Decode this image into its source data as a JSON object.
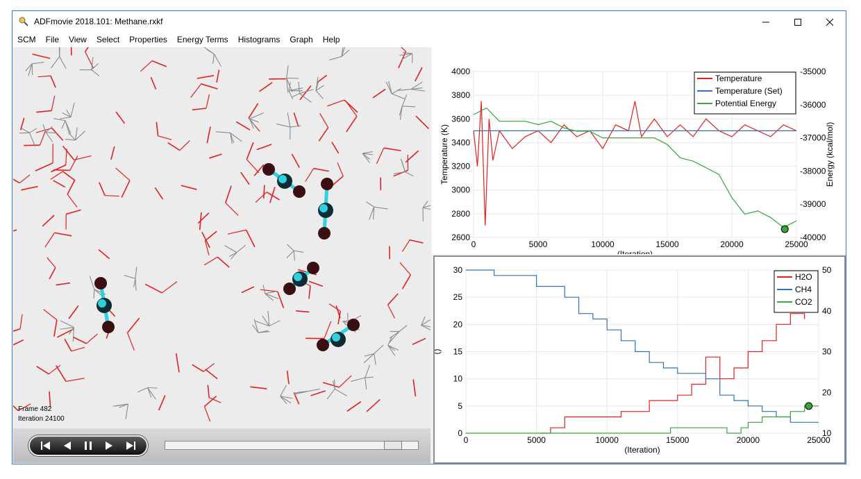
{
  "window": {
    "title": "ADFmovie 2018.101: Methane.rxkf"
  },
  "menu": [
    "SCM",
    "File",
    "View",
    "Select",
    "Properties",
    "Energy Terms",
    "Histograms",
    "Graph",
    "Help"
  ],
  "viewport": {
    "frame_label": "Frame 482",
    "iteration_label": "Iteration 24100"
  },
  "playback": {
    "position_fraction": 0.925
  },
  "colors": {
    "temperature": "#e02020",
    "temperature_set": "#2e74b5",
    "potential": "#3aa53a",
    "h2o": "#e02020",
    "ch4": "#2e74b5",
    "co2": "#3aa53a",
    "oxygen": "#3a0f12",
    "carbon": "#2fd0e0"
  },
  "chart_data": [
    {
      "type": "line",
      "xlabel": "(Iteration)",
      "ylabel": "Temperature (K)",
      "y2label": "Energy (kcal/mol)",
      "xlim": [
        0,
        25000
      ],
      "ylim": [
        2600,
        4000
      ],
      "y2lim": [
        -40000,
        -35000
      ],
      "xticks": [
        "0",
        "5000",
        "10000",
        "15000",
        "20000",
        "25000"
      ],
      "yticks": [
        "2600",
        "2800",
        "3000",
        "3200",
        "3400",
        "3600",
        "3800",
        "4000"
      ],
      "y2ticks": [
        "-40000",
        "-39000",
        "-38000",
        "-37000",
        "-36000",
        "-35000"
      ],
      "legend_position": "top-right",
      "grid": true,
      "marker": {
        "x": 24100,
        "y2": -39750
      },
      "series": [
        {
          "name": "Temperature",
          "axis": "left",
          "x": [
            0,
            300,
            600,
            900,
            1200,
            1500,
            2000,
            3000,
            4000,
            5000,
            6000,
            7000,
            8000,
            9000,
            10000,
            11000,
            12000,
            12500,
            13000,
            14000,
            15000,
            16000,
            17000,
            18000,
            19000,
            20000,
            21000,
            22000,
            23000,
            24000,
            25000
          ],
          "values": [
            3500,
            3200,
            3750,
            2700,
            3600,
            3250,
            3500,
            3350,
            3450,
            3500,
            3400,
            3550,
            3450,
            3500,
            3350,
            3550,
            3500,
            3750,
            3450,
            3600,
            3450,
            3550,
            3450,
            3600,
            3500,
            3450,
            3550,
            3500,
            3450,
            3550,
            3500
          ]
        },
        {
          "name": "Temperature (Set)",
          "axis": "left",
          "x": [
            0,
            25000
          ],
          "values": [
            3500,
            3500
          ]
        },
        {
          "name": "Potential Energy",
          "axis": "right",
          "x": [
            0,
            1000,
            2000,
            3000,
            4000,
            5000,
            6000,
            7000,
            8000,
            9000,
            10000,
            11000,
            12000,
            13000,
            14000,
            15000,
            16000,
            17000,
            18000,
            19000,
            20000,
            21000,
            22000,
            23000,
            24000,
            25000
          ],
          "values": [
            -36300,
            -36100,
            -36500,
            -36500,
            -36500,
            -36600,
            -36500,
            -36700,
            -36800,
            -36800,
            -37000,
            -37000,
            -37000,
            -37000,
            -37000,
            -37200,
            -37600,
            -37700,
            -37900,
            -38100,
            -38800,
            -39300,
            -39200,
            -39400,
            -39700,
            -39500
          ]
        }
      ]
    },
    {
      "type": "line",
      "xlabel": "(Iteration)",
      "ylabel": "()",
      "y2label": "()",
      "xlim": [
        0,
        25000
      ],
      "ylim": [
        0,
        30
      ],
      "y2lim": [
        10,
        50
      ],
      "xticks": [
        "0",
        "5000",
        "10000",
        "15000",
        "20000",
        "25000"
      ],
      "yticks": [
        "0",
        "5",
        "10",
        "15",
        "20",
        "25",
        "30"
      ],
      "y2ticks": [
        "10",
        "20",
        "30",
        "40",
        "50"
      ],
      "legend_position": "top-right",
      "grid": true,
      "marker": {
        "x": 24300,
        "y": 5
      },
      "series": [
        {
          "name": "H2O",
          "x": [
            5300,
            5700,
            6000,
            6500,
            7000,
            8000,
            10000,
            11000,
            12000,
            13000,
            14000,
            15000,
            16000,
            17000,
            17500,
            18000,
            19000,
            20000,
            21000,
            22000,
            23000,
            23500,
            24000
          ],
          "values": [
            0,
            0,
            1,
            1,
            3,
            3,
            3,
            4,
            4,
            6,
            6,
            7,
            9,
            14,
            14,
            10,
            12,
            15,
            17,
            20,
            22,
            22,
            21
          ]
        },
        {
          "name": "CH4",
          "x": [
            0,
            2000,
            3000,
            5000,
            6000,
            7000,
            8000,
            9000,
            10000,
            11000,
            12000,
            13000,
            14000,
            15000,
            16000,
            17000,
            17500,
            18000,
            19000,
            20000,
            21000,
            22000,
            23000,
            24000,
            25000
          ],
          "values": [
            30,
            29,
            29,
            27,
            27,
            25,
            22,
            21,
            19,
            17,
            15,
            13,
            12,
            11,
            11,
            10,
            10,
            7,
            6,
            5,
            4,
            3,
            2,
            2,
            2
          ]
        },
        {
          "name": "CO2",
          "x": [
            0,
            14000,
            14500,
            18000,
            18500,
            19000,
            19500,
            20000,
            21000,
            22000,
            23000,
            24000,
            25000
          ],
          "values": [
            0,
            0,
            1,
            1,
            0,
            0,
            1,
            2,
            3,
            3,
            4,
            5,
            5
          ]
        }
      ]
    }
  ]
}
